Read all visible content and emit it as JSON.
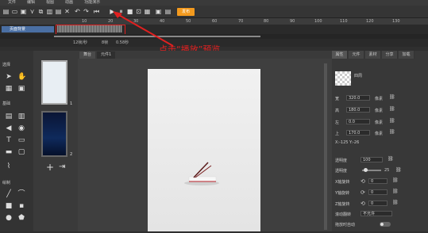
{
  "menu": [
    "文件",
    "编辑",
    "视图",
    "动画",
    "功能演示"
  ],
  "toolbar": {
    "publish_label": "发布"
  },
  "ruler": {
    "ticks": [
      "10",
      "20",
      "30",
      "40",
      "50",
      "60",
      "70",
      "80",
      "90",
      "100",
      "110",
      "120",
      "130"
    ]
  },
  "timeline": {
    "layer_label": "页面背景",
    "fps": "12帧/秒",
    "frame": "8帧",
    "time": "0.58秒"
  },
  "annotation": "点击“播放”预览",
  "canvas_tabs": [
    "舞台",
    "元件1"
  ],
  "tools": {
    "section_select": "选择",
    "section_shapes": "基础",
    "section_draw": "绘制"
  },
  "pages": [
    "1",
    "2"
  ],
  "right_tabs": [
    "属性",
    "元件",
    "素材",
    "分享",
    "加载"
  ],
  "props": {
    "name": "四周",
    "width_label": "宽",
    "width_value": "320.0",
    "width_unit": "像素",
    "height_label": "高",
    "height_value": "180.0",
    "height_unit": "像素",
    "x_label": "左",
    "x_value": "0.0",
    "x_unit": "像素",
    "y_label": "上",
    "y_value": "170.0",
    "y_unit": "像素",
    "coords": "X:-125   Y:-26",
    "opacity_label": "透明度",
    "opacity_value": "100",
    "blur_label": "透明度",
    "blur_value": "25",
    "rot_label": "X轴旋转",
    "rot_value": "0",
    "roty_label": "Y轴旋转",
    "roty_value": "0",
    "rotz_label": "Z轴旋转",
    "rotz_value": "0",
    "shadow_label": "滚动翻转",
    "shadow_value": "不允许",
    "drag_label": "拖放时自动"
  }
}
